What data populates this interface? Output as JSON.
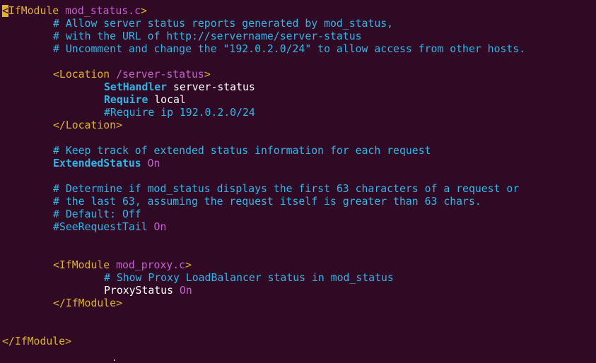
{
  "colors": {
    "background": "#300a24",
    "tag": "#e0b227",
    "argument": "#c55fd0",
    "comment": "#2fb6e8",
    "text": "#ffffff"
  },
  "editor": {
    "cursor_char": "<",
    "l1_tag_rest": "IfModule",
    "l1_arg": " mod_status.c",
    "l1_close": ">",
    "l2": "# Allow server status reports generated by mod_status,",
    "l3": "# with the URL of http://servername/server-status",
    "l4": "# Uncomment and change the \"192.0.2.0/24\" to allow access from other hosts.",
    "l6_open": "<Location",
    "l6_arg": " /server-status",
    "l6_close": ">",
    "l7_dir": "SetHandler",
    "l7_val": " server-status",
    "l8_dir": "Require",
    "l8_val": " local",
    "l9": "#Require ip 192.0.2.0/24",
    "l10": "</Location>",
    "l12": "# Keep track of extended status information for each request",
    "l13_dir": "ExtendedStatus",
    "l13_val": " On",
    "l15": "# Determine if mod_status displays the first 63 characters of a request or",
    "l16": "# the last 63, assuming the request itself is greater than 63 chars.",
    "l17": "# Default: Off",
    "l18_comment": "#SeeRequestTail",
    "l18_val": " On",
    "l21_open": "<IfModule",
    "l21_arg": " mod_proxy.c",
    "l21_close": ">",
    "l22": "# Show Proxy LoadBalancer status in mod_status",
    "l23_dir": "ProxyStatus",
    "l23_val": " On",
    "l24": "</IfModule>",
    "l27": "</IfModule>"
  }
}
